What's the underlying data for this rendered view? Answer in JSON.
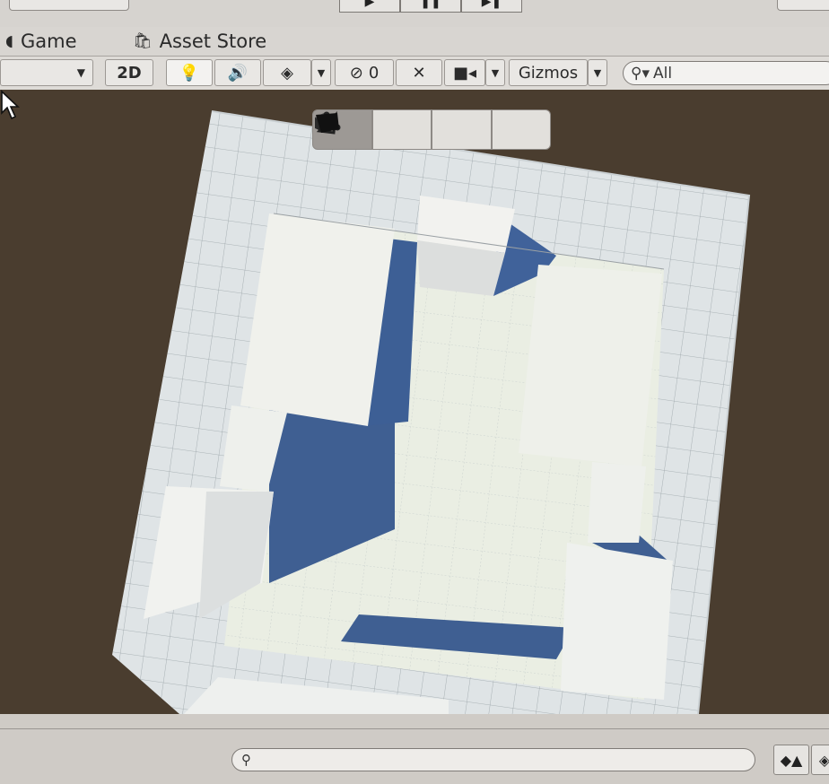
{
  "tabs": {
    "game_label": "Game",
    "asset_store_label": "Asset Store"
  },
  "toolbar": {
    "mode_2d_label": "2D",
    "hidden_count": "0",
    "gizmos_label": "Gizmos",
    "search_value": "All"
  },
  "scene": {
    "tool_names": [
      "solid-box-tool",
      "vertex-edit-tool",
      "edge-tool",
      "face-tool"
    ],
    "active_tool": "solid-box-tool"
  },
  "colors": {
    "background": "#4a3d2f",
    "floor": "#e9ede2",
    "wall_top": "#eef0ef",
    "shadow": "#3f5f92"
  }
}
